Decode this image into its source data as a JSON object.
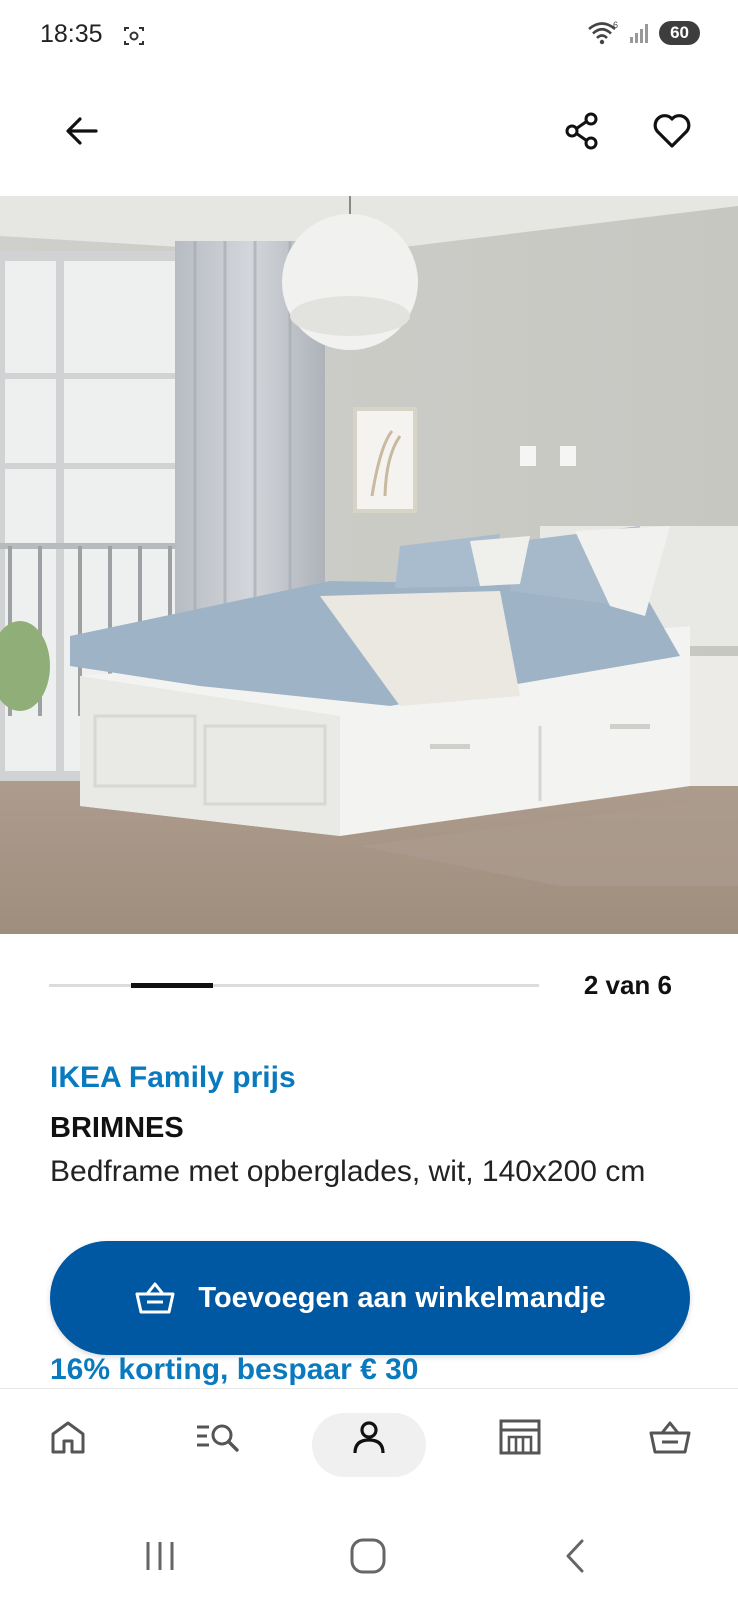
{
  "status_bar": {
    "time": "18:35",
    "battery": "60"
  },
  "icons": {
    "back": "arrow-left-icon",
    "share": "share-icon",
    "favorite": "heart-icon",
    "cart_button": "basket-icon"
  },
  "product_image": {
    "description_icon": "product-photo"
  },
  "carousel": {
    "counter": "2 van 6",
    "current": 2,
    "total": 6
  },
  "product": {
    "family_price_label": "IKEA Family prijs",
    "name": "BRIMNES",
    "description": "Bedframe met opberglades, wit, 140x200 cm",
    "discount": "16% korting, bespaar € 30"
  },
  "cta": {
    "label": "Toevoegen aan winkelmandje"
  },
  "bottom_nav": {
    "items": [
      "home-icon",
      "search-list-icon",
      "profile-icon",
      "store-icon",
      "basket-icon"
    ],
    "active": "profile-icon"
  },
  "colors": {
    "accent": "#0058a3",
    "family_blue": "#0a7abf"
  }
}
